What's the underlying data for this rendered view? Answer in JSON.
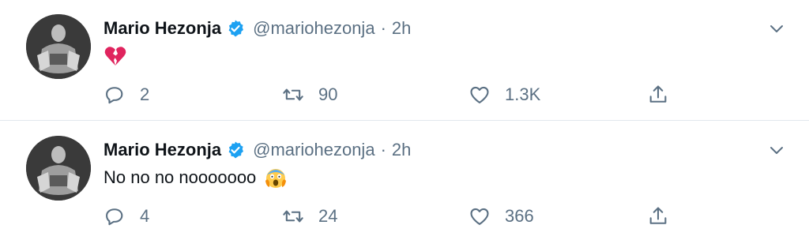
{
  "tweets": [
    {
      "author_name": "Mario Hezonja",
      "author_handle": "@mariohezonja",
      "separator": "·",
      "time": "2h",
      "text": "",
      "emoji": "broken-heart-emoji",
      "counts": {
        "reply": "2",
        "retweet": "90",
        "like": "1.3K"
      }
    },
    {
      "author_name": "Mario Hezonja",
      "author_handle": "@mariohezonja",
      "separator": "·",
      "time": "2h",
      "text": "No no no nooooooo",
      "emoji": "screaming-face-emoji",
      "counts": {
        "reply": "4",
        "retweet": "24",
        "like": "366"
      }
    }
  ],
  "colors": {
    "verified_blue": "#1da1f2",
    "muted_text": "#5b7083",
    "divider": "#e1e8ed",
    "broken_heart": "#e0245e"
  }
}
